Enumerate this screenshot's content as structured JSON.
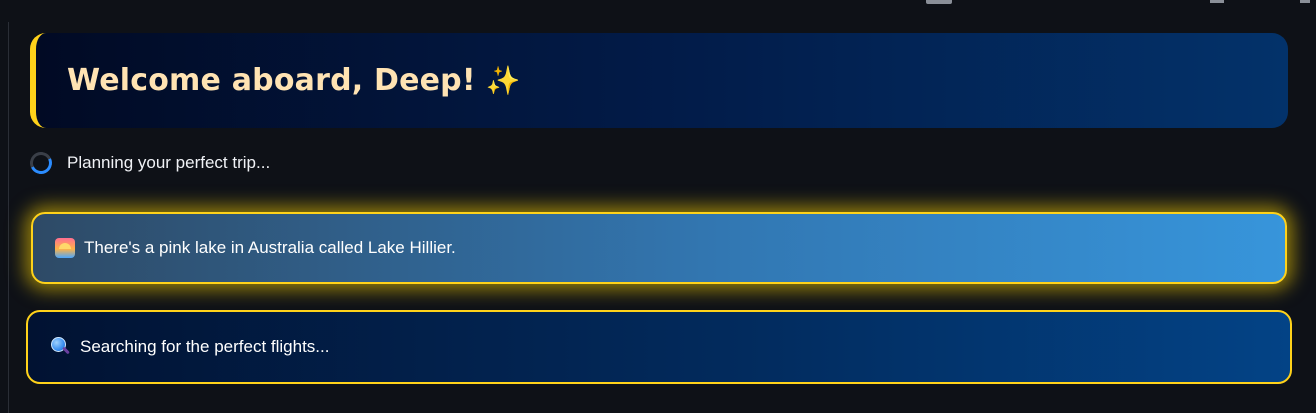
{
  "header": {
    "welcome_title": "Welcome aboard, Deep!",
    "welcome_emoji": "✨"
  },
  "status": {
    "text": "Planning your perfect trip..."
  },
  "fact_card": {
    "icon": "sunrise-icon",
    "text": "There's a pink lake in Australia called Lake Hillier."
  },
  "search_card": {
    "icon": "magnifier-icon",
    "text": "Searching for the perfect flights..."
  },
  "colors": {
    "background": "#0e1117",
    "accent_yellow": "#ffd21a",
    "title_color": "#ffe3b3",
    "spinner_blue": "#2b8cff"
  }
}
